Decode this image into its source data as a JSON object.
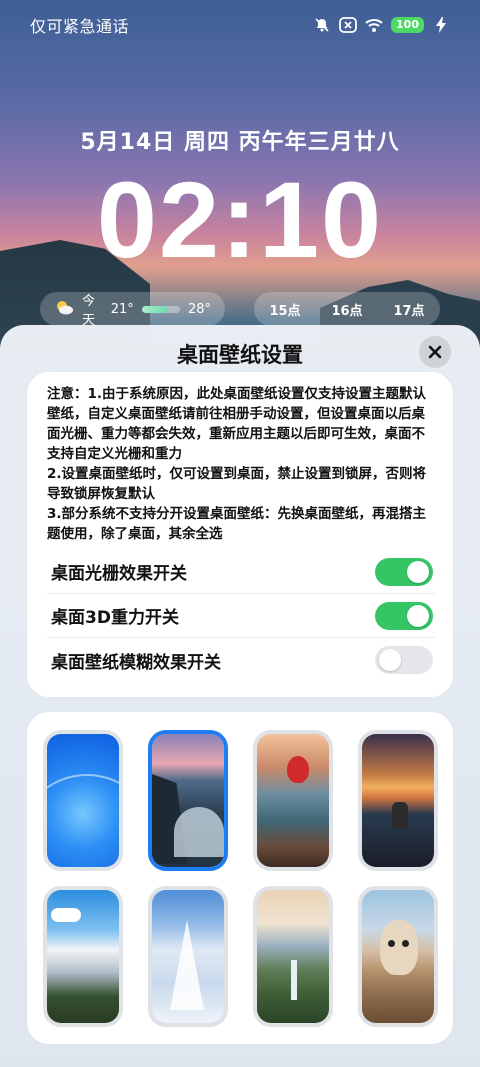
{
  "status_bar": {
    "left_text": "仅可紧急通话",
    "icons": [
      "bell-off-icon",
      "close-box-icon",
      "wifi-icon"
    ],
    "battery_level": "100"
  },
  "lockscreen": {
    "date": "5月14日 周四 丙午年三月廿八",
    "time": "02:10",
    "weather": {
      "label": "今天",
      "low": "21°",
      "high": "28°",
      "range_fill_fraction": 0.7
    },
    "hours": [
      "15点",
      "16点",
      "17点"
    ]
  },
  "sheet": {
    "title": "桌面壁纸设置",
    "notice": [
      "注意：1.由于系统原因，此处桌面壁纸设置仅支持设置主题默认壁纸，自定义桌面壁纸请前往相册手动设置，但设置桌面以后桌面光栅、重力等都会失效，重新应用主题以后即可生效，桌面不支持自定义光栅和重力",
      "2.设置桌面壁纸时，仅可设置到桌面，禁止设置到锁屏，否则将导致锁屏恢复默认",
      "3.部分系统不支持分开设置桌面壁纸：先换桌面壁纸，再混搭主题使用，除了桌面，其余全选"
    ],
    "toggles": [
      {
        "label": "桌面光栅效果开关",
        "on": true
      },
      {
        "label": "桌面3D重力开关",
        "on": true
      },
      {
        "label": "桌面壁纸模糊效果开关",
        "on": false
      }
    ],
    "wallpapers": [
      {
        "name": "blue-abstract",
        "selected": false
      },
      {
        "name": "coastal-cliffs",
        "selected": true
      },
      {
        "name": "hot-air-balloon",
        "selected": false
      },
      {
        "name": "cat-sunset",
        "selected": false
      },
      {
        "name": "mountain-lake",
        "selected": false
      },
      {
        "name": "snow-forest",
        "selected": false
      },
      {
        "name": "waterfall-valley",
        "selected": false
      },
      {
        "name": "alpaca",
        "selected": false
      }
    ]
  }
}
